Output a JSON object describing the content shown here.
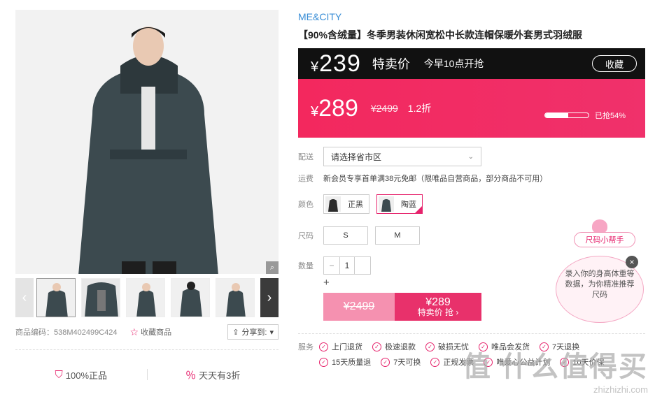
{
  "gallery": {
    "zoom_icon": "zoom-icon",
    "thumbnail_count": 6
  },
  "meta": {
    "code_label": "商品编码：538M402499C424",
    "fav_label": "收藏商品",
    "share_label": "分享到:"
  },
  "promises": [
    {
      "label": "100%正品"
    },
    {
      "label": "天天有3折"
    }
  ],
  "product": {
    "brand": "ME&CITY",
    "title": "【90%含绒量】冬季男装休闲宽松中长款连帽保暖外套男式羽绒服"
  },
  "flash": {
    "yen": "¥",
    "price": "239",
    "label": "特卖价",
    "time": "今早10点开抢",
    "collect": "收藏"
  },
  "sale": {
    "yen": "¥",
    "price": "289",
    "orig": "¥2499",
    "discount": "1.2折",
    "progress_label": "已抢54%",
    "progress": 0.54
  },
  "ship": {
    "label": "配送",
    "placeholder": "请选择省市区"
  },
  "fee": {
    "label": "运费",
    "text": "新会员专享首单满38元免邮（限唯品自营商品，部分商品不可用）"
  },
  "color": {
    "label": "颜色",
    "options": [
      {
        "label": "正黑"
      },
      {
        "label": "陶蓝"
      }
    ]
  },
  "size": {
    "label": "尺码",
    "options": [
      "S",
      "M"
    ]
  },
  "qty": {
    "label": "数量",
    "minus": "−",
    "value": "1",
    "plus": "+"
  },
  "buy": {
    "orig": "¥2499",
    "price": "¥289",
    "label": "特卖价 抢 ›"
  },
  "services": {
    "label": "服务",
    "items": [
      "上门退货",
      "极速退款",
      "破损无忧",
      "唯品会发货",
      "7天退换",
      "15天质量退",
      "7天可换",
      "正规发票",
      "唯爱心公益计划",
      "10天价保"
    ]
  },
  "helper": {
    "tag": "尺码小帮手",
    "bubble": "录入你的身高体重等数据，为你精准推荐尺码"
  },
  "watermark": {
    "big": "值 什么值得买",
    "small": "zhizhizhi.com"
  },
  "colors": {
    "accent": "#e6236c",
    "brand": "#3a8ed6",
    "dark": "#111111"
  }
}
